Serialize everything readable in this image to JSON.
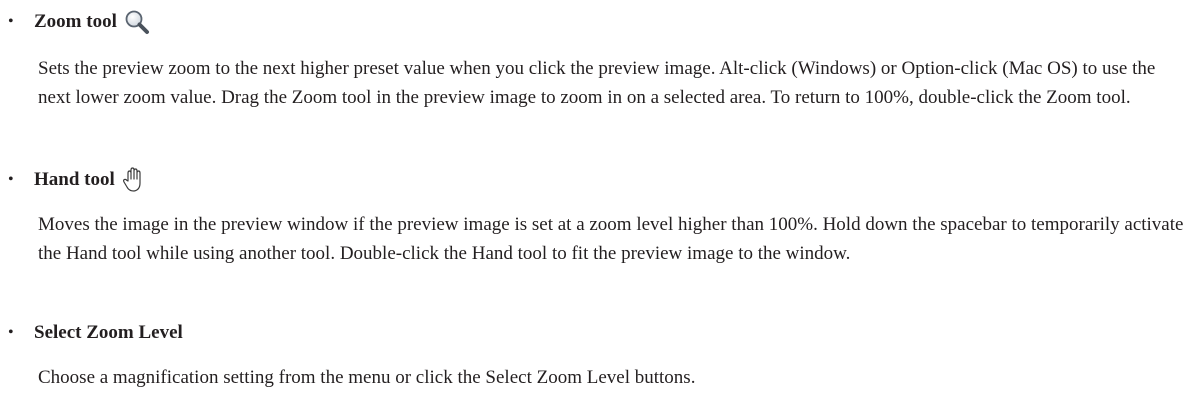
{
  "items": [
    {
      "term": "Zoom tool",
      "icon": "zoom-magnifier-icon",
      "description": "Sets the preview zoom to the next higher preset value when you click the preview image. Alt-click (Windows) or Option-click (Mac OS) to use the next lower zoom value. Drag the Zoom tool in the preview image to zoom in on a selected area. To return to 100%, double-click the Zoom tool."
    },
    {
      "term": "Hand tool",
      "icon": "hand-icon",
      "description": "Moves the image in the preview window if the preview image is set at a zoom level higher than 100%. Hold down the spacebar to temporarily activate the Hand tool while using another tool. Double-click the Hand tool to fit the preview image to the window."
    },
    {
      "term": "Select Zoom Level",
      "description": "Choose a magnification setting from the menu or click the Select Zoom Level buttons."
    }
  ],
  "bullet": "•"
}
